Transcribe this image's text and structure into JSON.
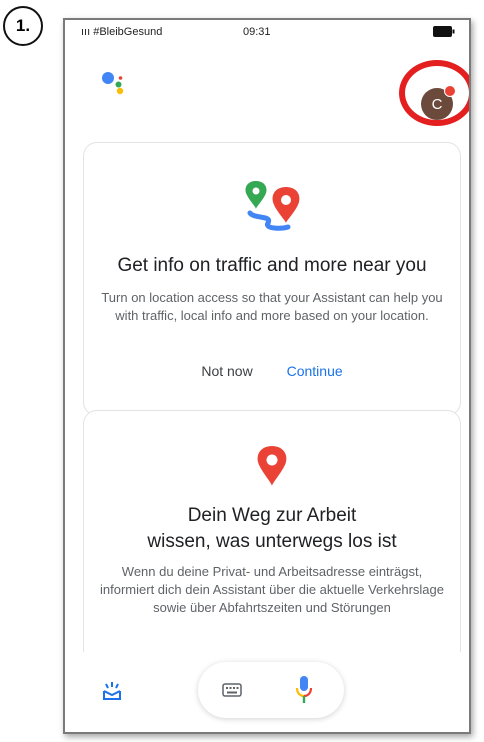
{
  "annotation": {
    "step_label": "1."
  },
  "statusbar": {
    "carrier": "ııı #BleibGesund",
    "time": "09:31",
    "right": ""
  },
  "profile": {
    "avatar_letter": "C"
  },
  "location_card": {
    "title": "Get info on traffic and more near you",
    "body": "Turn on location access so that your Assistant can help you with traffic, local info and more based on your location.",
    "not_now_label": "Not now",
    "continue_label": "Continue"
  },
  "commute_card": {
    "title_line1": "Dein Weg zur Arbeit",
    "title_line2": "wissen, was unterwegs los ist",
    "body": "Wenn du deine Privat- und Arbeitsadresse einträgst, informiert dich dein Assistant über die aktuelle Verkehrslage sowie über Abfahrtszeiten und Störungen"
  },
  "icons": [
    "assistant-logo",
    "traffic-route-icon",
    "location-pin-icon",
    "explore-icon",
    "keyboard-icon",
    "microphone-icon"
  ],
  "colors": {
    "blue": "#4285f4",
    "red": "#ea4335",
    "yellow": "#fbbc05",
    "green": "#34a853",
    "highlight": "#e41f1f",
    "link": "#1a73e8"
  }
}
